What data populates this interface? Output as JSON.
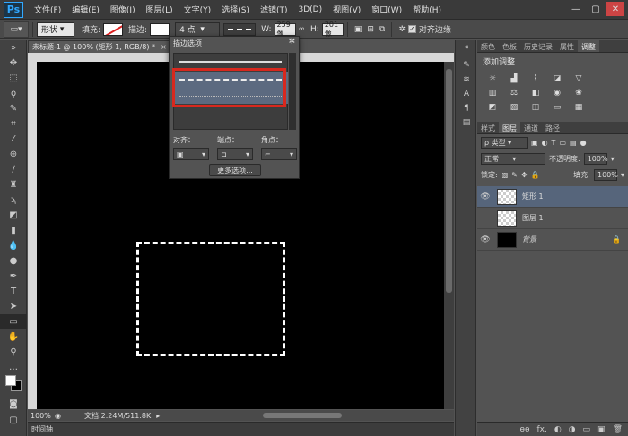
{
  "app": {
    "logo": "Ps"
  },
  "menu": [
    "文件(F)",
    "编辑(E)",
    "图像(I)",
    "图层(L)",
    "文字(Y)",
    "选择(S)",
    "滤镜(T)",
    "3D(D)",
    "视图(V)",
    "窗口(W)",
    "帮助(H)"
  ],
  "window_controls": [
    "—",
    "▢",
    "✕"
  ],
  "options": {
    "shape_mode": "形状",
    "fill_label": "填充:",
    "stroke_label": "描边:",
    "stroke_size": "4 点",
    "w_label": "W:",
    "w_value": "259 像",
    "h_label": "H:",
    "h_value": "201 像",
    "align_edges_label": "对齐边缘",
    "align_edges_checked": "✓"
  },
  "document": {
    "tab_title": "未标题-1 @ 100% (矩形 1, RGB/8) *",
    "close": "×",
    "zoom": "100%",
    "doc_info": "文档:2.24M/511.8K"
  },
  "timeline": "时间轴",
  "stroke_popup": {
    "title": "描边选项",
    "align_label": "对齐：",
    "caps_label": "端点：",
    "corners_label": "角点：",
    "more_button": "更多选项..."
  },
  "panels": {
    "top_tabs": [
      "颜色",
      "色板",
      "历史记录",
      "属性",
      "调整"
    ],
    "adjust_title": "添加调整",
    "layer_tabs": [
      "样式",
      "图层",
      "通道",
      "路径"
    ],
    "kind_filter": "ρ 类型",
    "blend_mode": "正常",
    "opacity_label": "不透明度:",
    "opacity_value": "100%",
    "lock_label": "锁定:",
    "fill_label": "填充:",
    "fill_value": "100%",
    "layers": [
      {
        "name": "矩形 1",
        "visible": "👁",
        "selected": true
      },
      {
        "name": "图层 1",
        "visible": "",
        "selected": false
      },
      {
        "name": "背景",
        "visible": "👁",
        "selected": false,
        "locked": "🔒"
      }
    ],
    "footer_icons": [
      "ɵɵ",
      "fx.",
      "◐",
      "◑",
      "▭",
      "▣",
      "🗑"
    ]
  },
  "colors": {
    "highlight": "#d8281e",
    "selected_layer": "#56657b"
  }
}
